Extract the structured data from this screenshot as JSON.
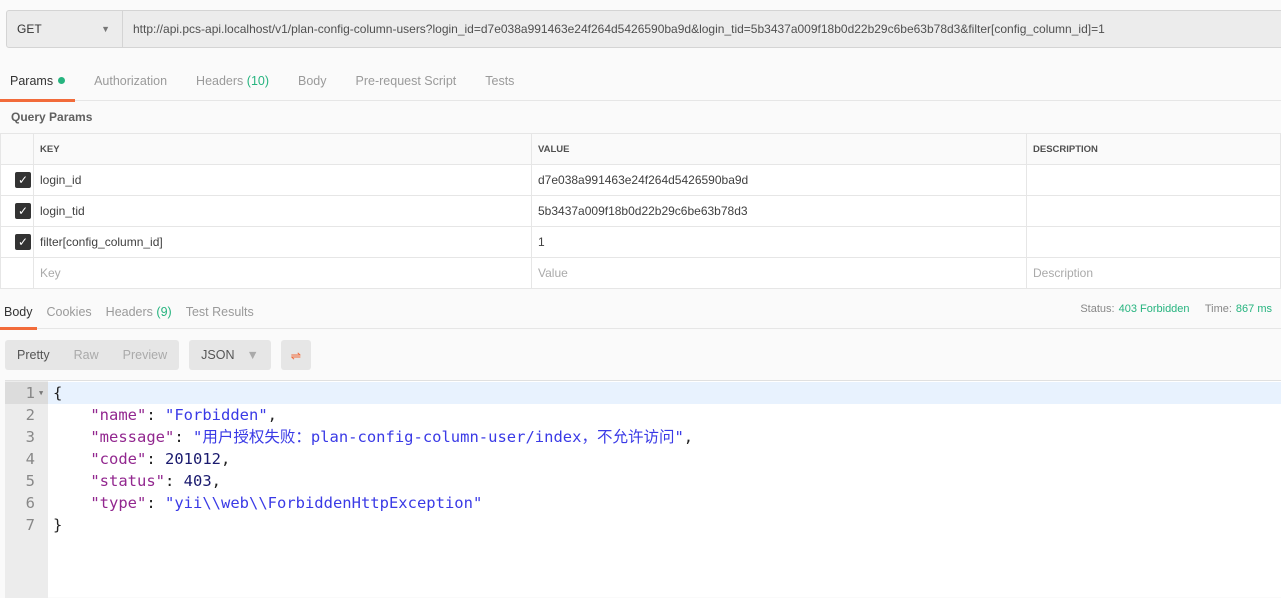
{
  "request": {
    "method": "GET",
    "url": "http://api.pcs-api.localhost/v1/plan-config-column-users?login_id=d7e038a991463e24f264d5426590ba9d&login_tid=5b3437a009f18b0d22b29c6be63b78d3&filter[config_column_id]=1"
  },
  "tabs": {
    "params": "Params",
    "authorization": "Authorization",
    "headers": "Headers",
    "headers_count": "(10)",
    "body": "Body",
    "prerequest": "Pre-request Script",
    "tests": "Tests"
  },
  "query_params": {
    "title": "Query Params",
    "columns": [
      "KEY",
      "VALUE",
      "DESCRIPTION"
    ],
    "rows": [
      {
        "key": "login_id",
        "value": "d7e038a991463e24f264d5426590ba9d",
        "description": "",
        "checked": true
      },
      {
        "key": "login_tid",
        "value": "5b3437a009f18b0d22b29c6be63b78d3",
        "description": "",
        "checked": true
      },
      {
        "key": "filter[config_column_id]",
        "value": "1",
        "description": "",
        "checked": true
      }
    ],
    "placeholders": {
      "key": "Key",
      "value": "Value",
      "description": "Description"
    }
  },
  "response": {
    "tabs": {
      "body": "Body",
      "cookies": "Cookies",
      "headers": "Headers",
      "headers_count": "(9)",
      "test_results": "Test Results"
    },
    "status_label": "Status:",
    "status": "403 Forbidden",
    "time_label": "Time:",
    "time": "867 ms",
    "views": [
      "Pretty",
      "Raw",
      "Preview"
    ],
    "format": "JSON",
    "lines": {
      "l1": "{",
      "l2k": "\"name\"",
      "l2v": "\"Forbidden\"",
      "l3k": "\"message\"",
      "l3v": "\"用户授权失败：plan-config-column-user/index，不允许访问\"",
      "l4k": "\"code\"",
      "l4v": "201012",
      "l5k": "\"status\"",
      "l5v": "403",
      "l6k": "\"type\"",
      "l6v": "\"yii\\\\web\\\\ForbiddenHttpException\"",
      "l7": "}"
    }
  }
}
